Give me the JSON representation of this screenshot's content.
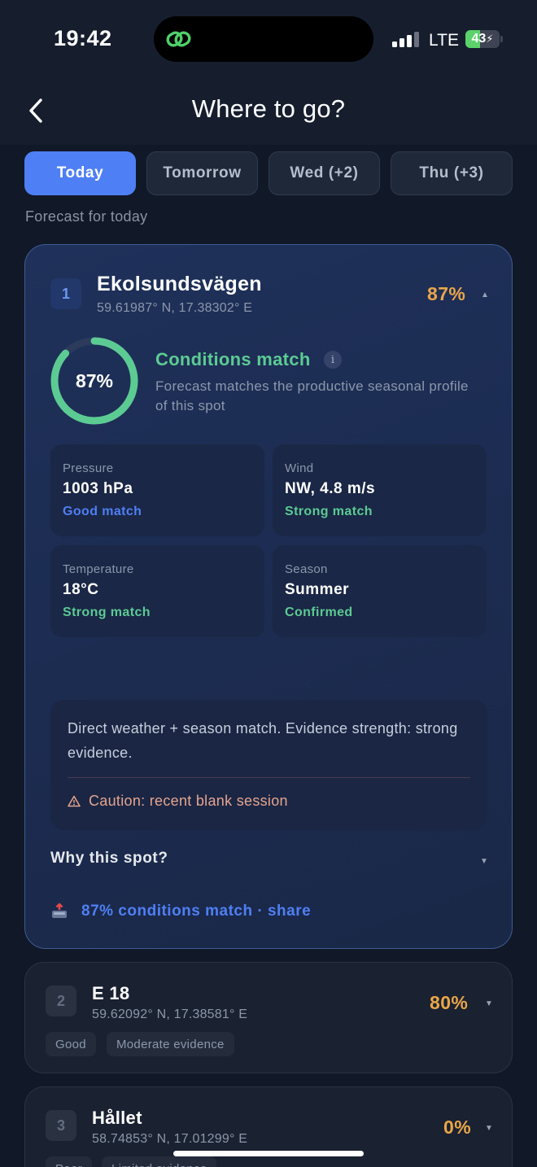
{
  "status": {
    "time": "19:42",
    "network": "LTE",
    "battery": "43",
    "battery_level": 0.43
  },
  "header": {
    "title": "Where to go?"
  },
  "tabs": [
    {
      "label": "Today"
    },
    {
      "label": "Tomorrow"
    },
    {
      "label": "Wed (+2)"
    },
    {
      "label": "Thu (+3)"
    }
  ],
  "forecast_label": "Forecast for today",
  "spots": [
    {
      "rank": "1",
      "name": "Ekolsundsvägen",
      "coords": "59.61987° N, 17.38302° E",
      "score": "87%",
      "match_ring": "87%",
      "match_fraction": 0.87,
      "conditions_title": "Conditions match",
      "conditions_desc": "Forecast matches the productive seasonal profile of this spot",
      "metrics": [
        {
          "label": "Pressure",
          "value": "1003 hPa",
          "status": "Good match"
        },
        {
          "label": "Wind",
          "value": "NW, 4.8 m/s",
          "status": "Strong match"
        },
        {
          "label": "Temperature",
          "value": "18°C",
          "status": "Strong match"
        },
        {
          "label": "Season",
          "value": "Summer",
          "status": "Confirmed"
        }
      ],
      "evidence": "Direct weather + season match. Evidence strength: strong evidence.",
      "caution": "Caution: recent blank session",
      "why": "Why this spot?",
      "share": "87% conditions match · share"
    },
    {
      "rank": "2",
      "name": "E 18",
      "coords": "59.62092° N, 17.38581° E",
      "score": "80%",
      "tags": [
        "Good",
        "Moderate evidence"
      ]
    },
    {
      "rank": "3",
      "name": "Hållet",
      "coords": "58.74853° N, 17.01299° E",
      "score": "0%",
      "tags": [
        "Poor",
        "Limited evidence"
      ]
    }
  ],
  "colors": {
    "accent": "#4f7ff4",
    "score": "#e9a649",
    "strong": "#5ccb93",
    "good": "#4f7ff4",
    "caution": "#e6a48e"
  }
}
